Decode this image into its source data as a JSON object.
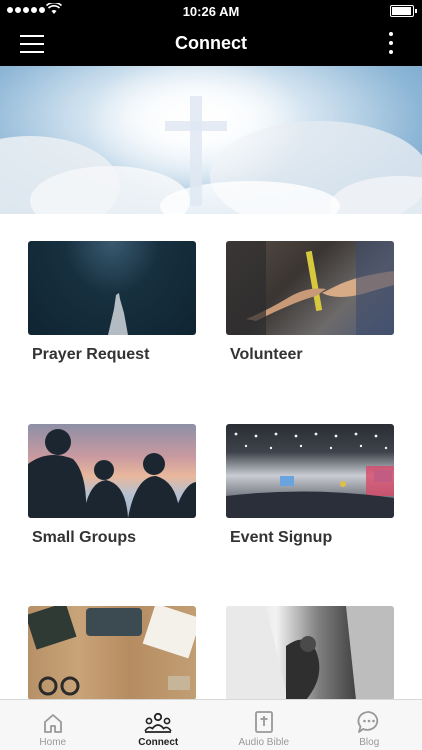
{
  "status": {
    "time": "10:26 AM"
  },
  "header": {
    "title": "Connect"
  },
  "cards": [
    {
      "label": "Prayer Request"
    },
    {
      "label": "Volunteer"
    },
    {
      "label": "Small Groups"
    },
    {
      "label": "Event Signup"
    },
    {
      "label": ""
    },
    {
      "label": ""
    }
  ],
  "tabs": [
    {
      "label": "Home",
      "icon": "home-icon"
    },
    {
      "label": "Connect",
      "icon": "people-icon",
      "active": true
    },
    {
      "label": "Audio Bible",
      "icon": "bible-icon"
    },
    {
      "label": "Blog",
      "icon": "chat-icon"
    }
  ],
  "colors": {
    "bar": "#000000",
    "active_tab": "#222222",
    "inactive_tab": "#999999",
    "label": "#333333"
  }
}
